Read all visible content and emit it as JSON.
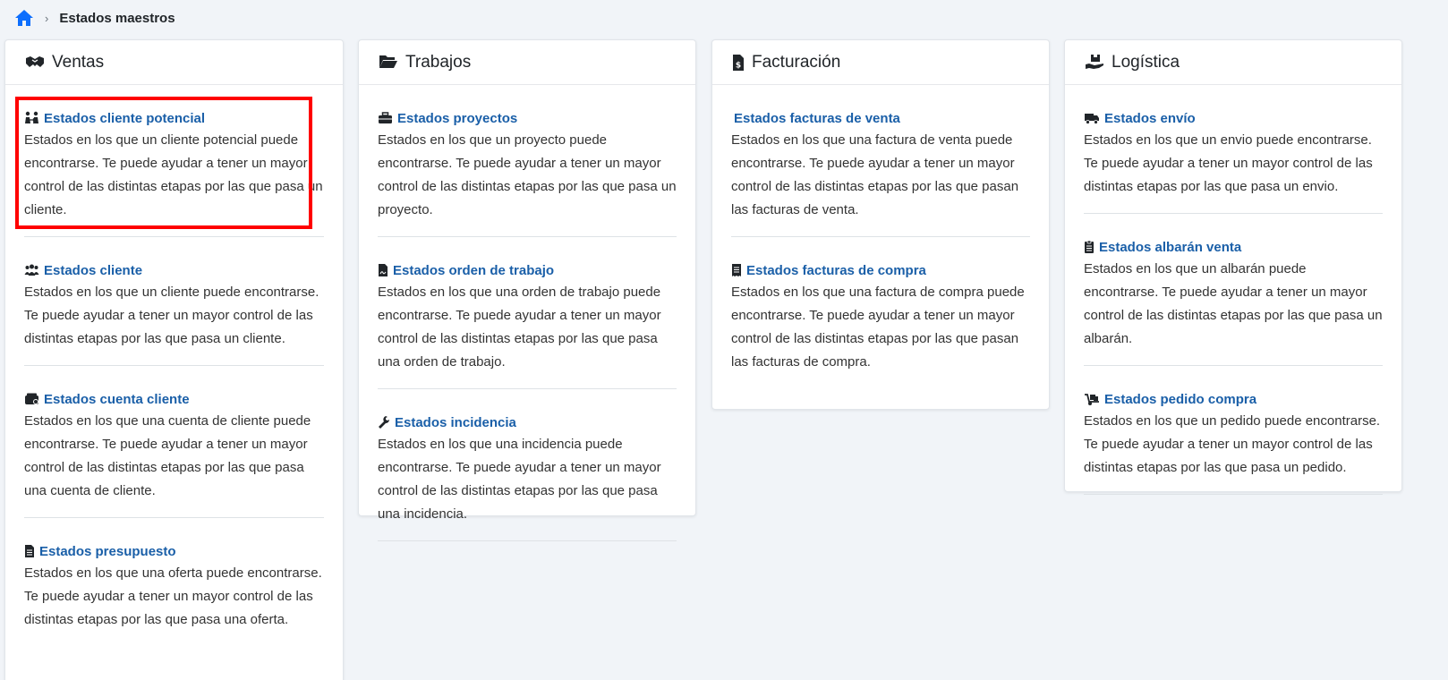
{
  "breadcrumb": {
    "current": "Estados maestros"
  },
  "columns": [
    {
      "title": "Ventas",
      "icon": "handshake-icon",
      "items": [
        {
          "title": "Estados cliente potencial",
          "icon": "people-arrows-icon",
          "text": "Estados en los que un cliente potencial puede encontrarse. Te puede ayudar a tener un mayor control de las distintas etapas por las que pasa un cliente."
        },
        {
          "title": "Estados cliente",
          "icon": "users-icon",
          "text": "Estados en los que un cliente puede encontrarse. Te puede ayudar a tener un mayor control de las distintas etapas por las que pasa un cliente."
        },
        {
          "title": "Estados cuenta cliente",
          "icon": "wallet-icon",
          "text": "Estados en los que una cuenta de cliente puede encontrarse. Te puede ayudar a tener un mayor control de las distintas etapas por las que pasa una cuenta de cliente."
        },
        {
          "title": "Estados presupuesto",
          "icon": "file-lines-icon",
          "text": "Estados en los que una oferta puede encontrarse. Te puede ayudar a tener un mayor control de las distintas etapas por las que pasa una oferta."
        }
      ]
    },
    {
      "title": "Trabajos",
      "icon": "folder-open-icon",
      "items": [
        {
          "title": "Estados proyectos",
          "icon": "briefcase-icon",
          "text": "Estados en los que un proyecto puede encontrarse. Te puede ayudar a tener un mayor control de las distintas etapas por las que pasa un proyecto."
        },
        {
          "title": "Estados orden de trabajo",
          "icon": "file-signature-icon",
          "text": "Estados en los que una orden de trabajo puede encontrarse. Te puede ayudar a tener un mayor control de las distintas etapas por las que pasa una orden de trabajo."
        },
        {
          "title": "Estados incidencia",
          "icon": "wrench-icon",
          "text": "Estados en los que una incidencia puede encontrarse. Te puede ayudar a tener un mayor control de las distintas etapas por las que pasa una incidencia."
        }
      ]
    },
    {
      "title": "Facturación",
      "icon": "file-invoice-dollar-icon",
      "items": [
        {
          "title": "Estados facturas de venta",
          "icon": "",
          "text": "Estados en los que una factura de venta puede encontrarse. Te puede ayudar a tener un mayor control de las distintas etapas por las que pasan las facturas de venta."
        },
        {
          "title": "Estados facturas de compra",
          "icon": "receipt-icon",
          "text": "Estados en los que una factura de compra puede encontrarse. Te puede ayudar a tener un mayor control de las distintas etapas por las que pasan las facturas de compra."
        }
      ]
    },
    {
      "title": "Logística",
      "icon": "hand-holding-box-icon",
      "items": [
        {
          "title": "Estados envío",
          "icon": "truck-fast-icon",
          "text": "Estados en los que un envio puede encontrarse. Te puede ayudar a tener un mayor control de las distintas etapas por las que pasa un envio."
        },
        {
          "title": "Estados albarán venta",
          "icon": "clipboard-list-icon",
          "text": "Estados en los que un albarán puede encontrarse. Te puede ayudar a tener un mayor control de las distintas etapas por las que pasa un albarán."
        },
        {
          "title": "Estados pedido compra",
          "icon": "dolly-icon",
          "text": "Estados en los que un pedido puede encontrarse. Te puede ayudar a tener un mayor control de las distintas etapas por las que pasa un pedido."
        }
      ]
    }
  ],
  "colors": {
    "link": "#1a5fa8",
    "highlight": "#ff0000",
    "home_icon": "#0d6efd"
  }
}
